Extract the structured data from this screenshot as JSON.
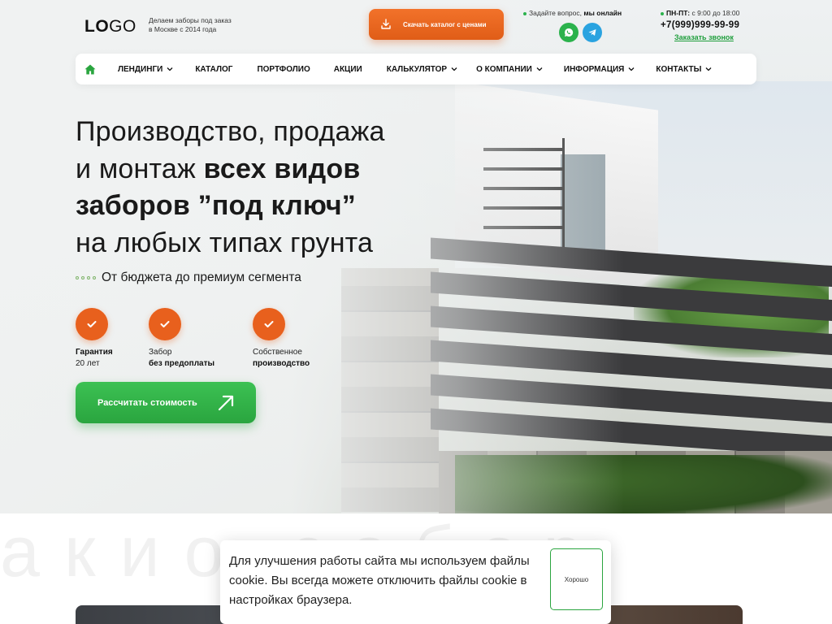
{
  "header": {
    "logo_bold": "LO",
    "logo_rest": "GO",
    "tagline_1": "Делаем заборы под заказ",
    "tagline_2": "в Москве с 2014 года",
    "catalog_button": "Скачать каталог с ценами",
    "ask_text": "Задайте вопрос,",
    "ask_online": "мы онлайн",
    "hours_days": "ПН-ПТ:",
    "hours_time": "с 9:00 до 18:00",
    "phone": "+7(999)999-99-99",
    "callback": "Заказать звонок"
  },
  "nav": {
    "items": [
      {
        "label": "Лендинги",
        "dropdown": true
      },
      {
        "label": "Каталог",
        "dropdown": false
      },
      {
        "label": "Портфолио",
        "dropdown": false
      },
      {
        "label": "Акции",
        "dropdown": false
      },
      {
        "label": "Калькулятор",
        "dropdown": true
      },
      {
        "label": "О компании",
        "dropdown": true
      },
      {
        "label": "Информация",
        "dropdown": true
      },
      {
        "label": "Контакты",
        "dropdown": true
      }
    ]
  },
  "hero": {
    "line1": "Производство, продажа",
    "line2_light": "и монтаж ",
    "line2_bold": "всех видов",
    "line3_bold": "заборов ”под ключ”",
    "line4": "на любых типах грунта",
    "subtitle": "От бюджета до премиум сегмента",
    "features": [
      {
        "title": "Гарантия",
        "text": "20 лет",
        "bold_first": true
      },
      {
        "title": "Забор",
        "text": "без предоплаты",
        "bold_first": false
      },
      {
        "title": "Собственное",
        "text": "производство",
        "bold_first": false
      }
    ],
    "cta": "Рассчитать стоимость"
  },
  "background_word": "акио забор",
  "cookie": {
    "text": "Для улучшения работы сайта мы используем файлы cookie. Вы всегда можете отключить файлы cookie в настройках браузера.",
    "button": "Хорошо"
  },
  "colors": {
    "accent_orange": "#e8601d",
    "accent_green": "#2aa53f",
    "whatsapp": "#2bb24c",
    "telegram": "#2aa3e0"
  },
  "icons": [
    "download-icon",
    "whatsapp-icon",
    "telegram-icon",
    "home-icon",
    "chevron-down-icon",
    "check-icon",
    "arrow-up-right-icon"
  ]
}
